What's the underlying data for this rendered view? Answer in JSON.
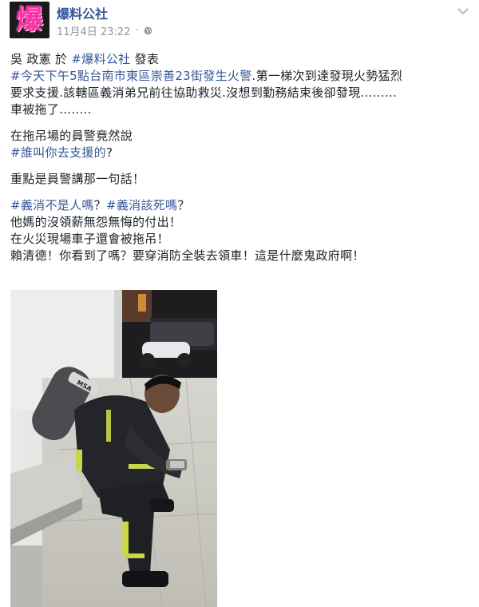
{
  "page": {
    "avatar_text": "爆",
    "name": "爆料公社",
    "date": "11月4日 23:22",
    "dot": "·"
  },
  "post": {
    "line1_author": "吳 政憲 於 ",
    "line1_tag": "#爆料公社",
    "line1_tail": " 發表",
    "line2_tag": "#今天下午5點台南市東區崇善23街發生火警",
    "line2_tail": ".第一梯次到達發現火勢猛烈",
    "line3": "要求支援.該轄區義消弟兄前往協助救災.沒想到勤務結束後卻發現.........",
    "line4": "車被拖了........",
    "line5": "在拖吊場的員警竟然說",
    "line6_tag": "#誰叫你去支援的",
    "line6_tail": "?",
    "line7": "重點是員警講那一句話！",
    "line8_tag1": "#義消不是人嗎",
    "line8_mid": "？",
    "line8_tag2": "#義消該死嗎",
    "line8_tail": "？",
    "line9": "他媽的沒領薪無怨無悔的付出！",
    "line10": "在火災現場車子還會被拖吊！",
    "line11": "賴清德！你看到了嗎？要穿消防全裝去領車！這是什麼鬼政府啊！"
  },
  "photo": {
    "tank_label": "MSA"
  },
  "colors": {
    "link": "#365899",
    "meta": "#90949c",
    "text": "#1d2129"
  },
  "icons": [
    "globe-icon",
    "chevron-down-icon"
  ]
}
